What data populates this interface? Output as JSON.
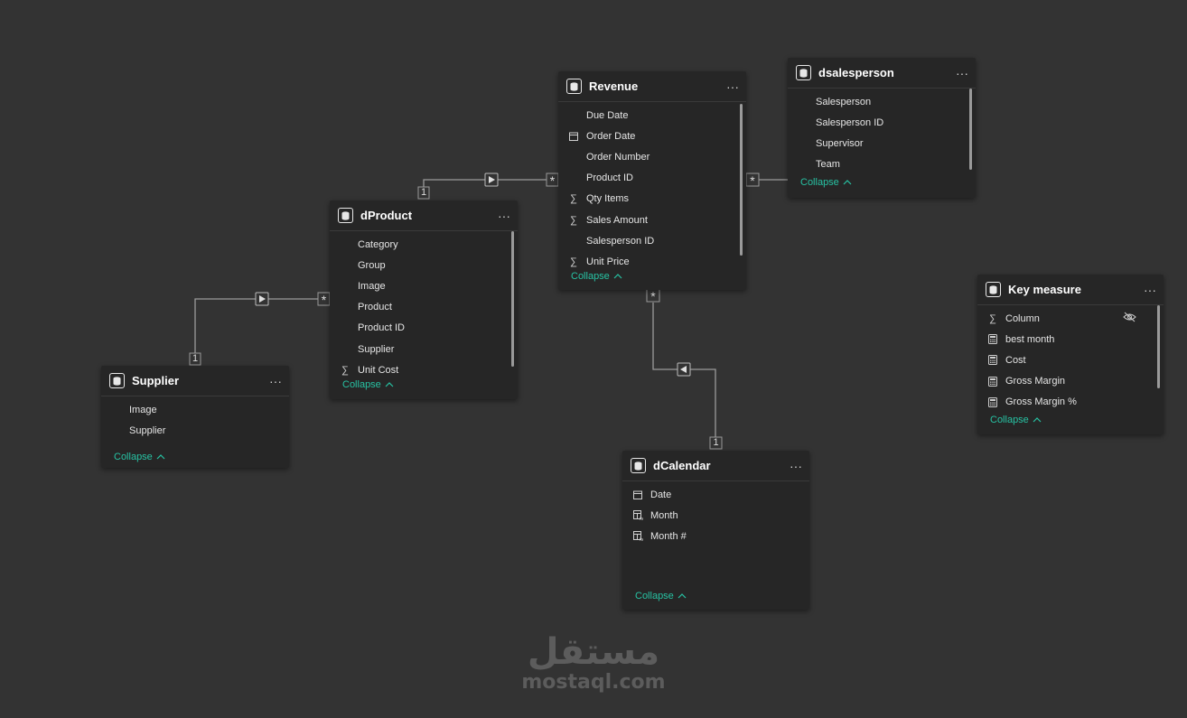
{
  "tables": {
    "revenue": {
      "title": "Revenue",
      "fields": [
        "Due Date",
        "Order Date",
        "Order Number",
        "Product ID",
        "Qty Items",
        "Sales Amount",
        "Salesperson ID",
        "Unit Price"
      ],
      "collapse_label": "Collapse"
    },
    "dsalesperson": {
      "title": "dsalesperson",
      "fields": [
        "Salesperson",
        "Salesperson ID",
        "Supervisor",
        "Team"
      ],
      "collapse_label": "Collapse"
    },
    "dproduct": {
      "title": "dProduct",
      "fields": [
        "Category",
        "Group",
        "Image",
        "Product",
        "Product ID",
        "Supplier",
        "Unit Cost"
      ],
      "collapse_label": "Collapse"
    },
    "supplier": {
      "title": "Supplier",
      "fields": [
        "Image",
        "Supplier"
      ],
      "collapse_label": "Collapse"
    },
    "dcalendar": {
      "title": "dCalendar",
      "fields": [
        "Date",
        "Month",
        "Month #"
      ],
      "collapse_label": "Collapse"
    },
    "key_measure": {
      "title": "Key measure",
      "fields": [
        "Column",
        "best month",
        "Cost",
        "Gross Margin",
        "Gross Margin %"
      ],
      "collapse_label": "Collapse"
    }
  },
  "cardinality": {
    "one": "1",
    "many": "*"
  },
  "watermark": {
    "arabic": "مستقل",
    "latin": "mostaql.com"
  },
  "colors": {
    "background": "#333333",
    "card": "#262626",
    "accent": "#27c2a3",
    "line": "#9a9a9a"
  }
}
